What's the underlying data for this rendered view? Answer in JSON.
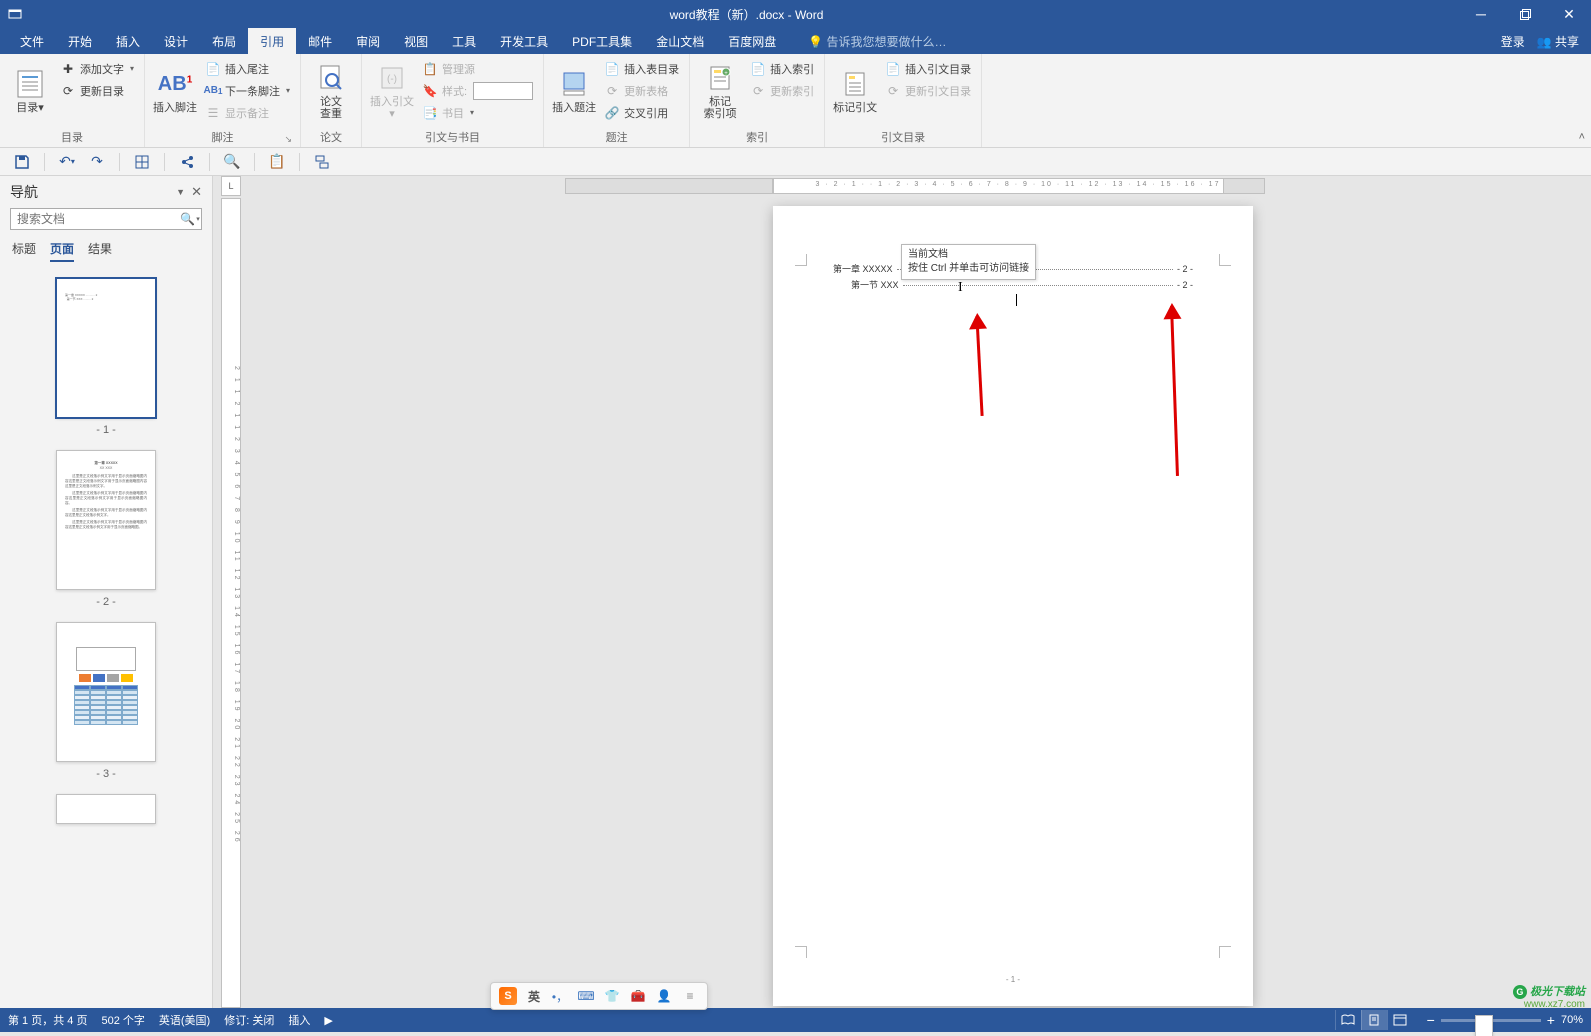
{
  "titlebar": {
    "title": "word教程（新）.docx - Word"
  },
  "menu": {
    "tabs": [
      "文件",
      "开始",
      "插入",
      "设计",
      "布局",
      "引用",
      "邮件",
      "审阅",
      "视图",
      "工具",
      "开发工具",
      "PDF工具集",
      "金山文档",
      "百度网盘"
    ],
    "active": "引用",
    "tell_me": "告诉我您想要做什么…",
    "login": "登录",
    "share": "共享"
  },
  "ribbon": {
    "toc": {
      "group": "目录",
      "toc": "目录",
      "add_text": "添加文字",
      "update_toc": "更新目录"
    },
    "fn": {
      "group": "脚注",
      "insert_fn": "插入脚注",
      "insert_en": "插入尾注",
      "next_fn": "下一条脚注",
      "show_notes": "显示备注"
    },
    "research": {
      "group": "论文",
      "lookup": "论文\n查重"
    },
    "cite": {
      "group": "引文与书目",
      "insert_cite": "插入引文",
      "manage_sources": "管理源",
      "style": "样式:",
      "bibliography": "书目"
    },
    "caption": {
      "group": "题注",
      "insert_caption": "插入题注",
      "insert_tof": "插入表目录",
      "update_table": "更新表格",
      "cross_ref": "交叉引用"
    },
    "index": {
      "group": "索引",
      "mark_entry": "标记\n索引项",
      "insert_index": "插入索引",
      "update_index": "更新索引"
    },
    "toa": {
      "group": "引文目录",
      "mark_citation": "标记引文",
      "insert_toa": "插入引文目录",
      "update_toa": "更新引文目录"
    }
  },
  "nav": {
    "title": "导航",
    "search_placeholder": "搜索文档",
    "tabs": [
      "标题",
      "页面",
      "结果"
    ],
    "active_tab": "页面",
    "thumbs": [
      "- 1 -",
      "- 2 -",
      "- 3 -"
    ]
  },
  "doc": {
    "toc_line1_title": "第一章  XXXXX",
    "toc_line1_page": "- 2 -",
    "toc_line2_title": "第一节  XXX",
    "toc_line2_page": "- 2 -",
    "tooltip_l1": "当前文档",
    "tooltip_l2": "按住 Ctrl 并单击可访问链接",
    "page_number": "- 1 -"
  },
  "status": {
    "page": "第 1 页，共 4 页",
    "words": "502 个字",
    "lang": "英语(美国)",
    "track": "修订: 关闭",
    "insert": "插入",
    "zoom_pct": "70%"
  },
  "ime": {
    "lang": "英"
  },
  "watermark": {
    "l1": "极光下载站",
    "l2": "www.xz7.com"
  },
  "ruler": {
    "horizontal": "3 · 2 · 1 ·  · 1 · 2 · 3 · 4 · 5 · 6 · 7 · 8 · 9 · 10 · 11 · 12 · 13 · 14 · 15 · 16 · 17",
    "vertical": "2 1  1 2 1 1 2 3 4 5 6 7 8 9 10 11 12 13 14 15 16 17 18 19 20 21 22 23 24 25 26"
  }
}
